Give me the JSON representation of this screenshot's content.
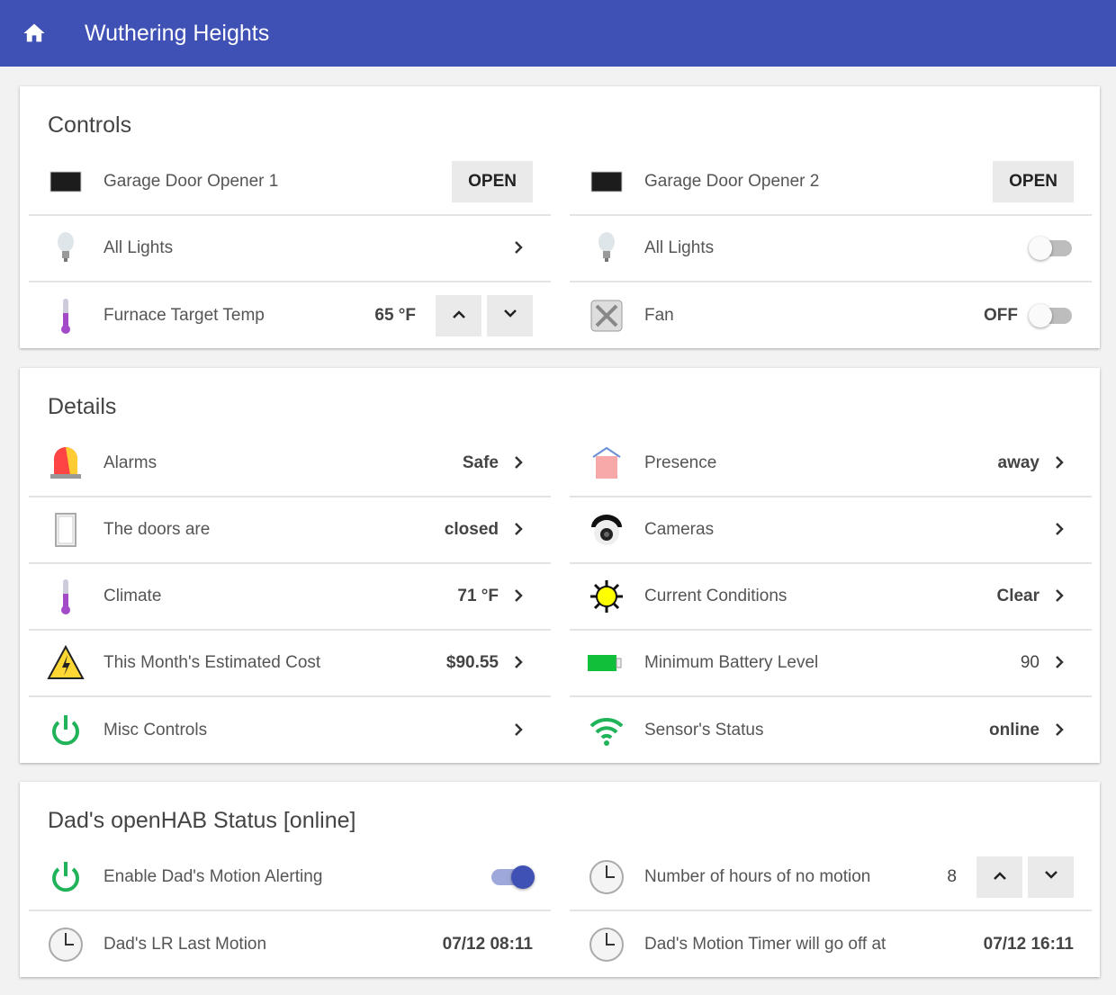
{
  "header": {
    "title": "Wuthering Heights",
    "icon": "home-icon"
  },
  "cards": [
    {
      "title": "Controls",
      "cols": [
        [
          {
            "icon": "garage-door",
            "label": "Garage Door Opener 1",
            "button": "OPEN"
          },
          {
            "icon": "bulb",
            "label": "All Lights",
            "chevron": true
          },
          {
            "icon": "thermometer",
            "label": "Furnace Target Temp",
            "value": "65 °F",
            "stepper": true
          }
        ],
        [
          {
            "icon": "garage-door",
            "label": "Garage Door Opener 2",
            "button": "OPEN"
          },
          {
            "icon": "bulb",
            "label": "All Lights",
            "toggle": false
          },
          {
            "icon": "fan",
            "label": "Fan",
            "value": "OFF",
            "toggle": false
          }
        ]
      ]
    },
    {
      "title": "Details",
      "cols": [
        [
          {
            "icon": "siren",
            "label": "Alarms",
            "value": "Safe",
            "chevron": true
          },
          {
            "icon": "door",
            "label": "The doors are",
            "value": "closed",
            "chevron": true
          },
          {
            "icon": "thermometer",
            "label": "Climate",
            "value": "71 °F",
            "chevron": true
          },
          {
            "icon": "warning",
            "label": "This Month's Estimated Cost",
            "value": "$90.55",
            "chevron": true
          },
          {
            "icon": "power",
            "label": "Misc Controls",
            "chevron": true
          }
        ],
        [
          {
            "icon": "house",
            "label": "Presence",
            "value": "away",
            "chevron": true
          },
          {
            "icon": "camera",
            "label": "Cameras",
            "chevron": true
          },
          {
            "icon": "sun",
            "label": "Current Conditions",
            "value": "Clear",
            "chevron": true
          },
          {
            "icon": "battery",
            "label": "Minimum Battery Level",
            "value": "90",
            "plain": true,
            "chevron": true
          },
          {
            "icon": "wifi",
            "label": "Sensor's Status",
            "value": "online",
            "chevron": true
          }
        ]
      ]
    },
    {
      "title": "Dad's openHAB Status [online]",
      "cols": [
        [
          {
            "icon": "power",
            "label": "Enable Dad's Motion Alerting",
            "toggle": true
          },
          {
            "icon": "clock",
            "label": "Dad's LR Last Motion",
            "value": "07/12 08:11",
            "endpad": true
          }
        ],
        [
          {
            "icon": "clock",
            "label": "Number of hours of no motion",
            "value": "8",
            "plain": true,
            "stepper": true
          },
          {
            "icon": "clock",
            "label": "Dad's Motion Timer will go off at",
            "value": "07/12 16:11",
            "endpad": true
          }
        ]
      ]
    }
  ],
  "colors": {
    "primary": "#3f51b5",
    "green": "#21b35a"
  }
}
